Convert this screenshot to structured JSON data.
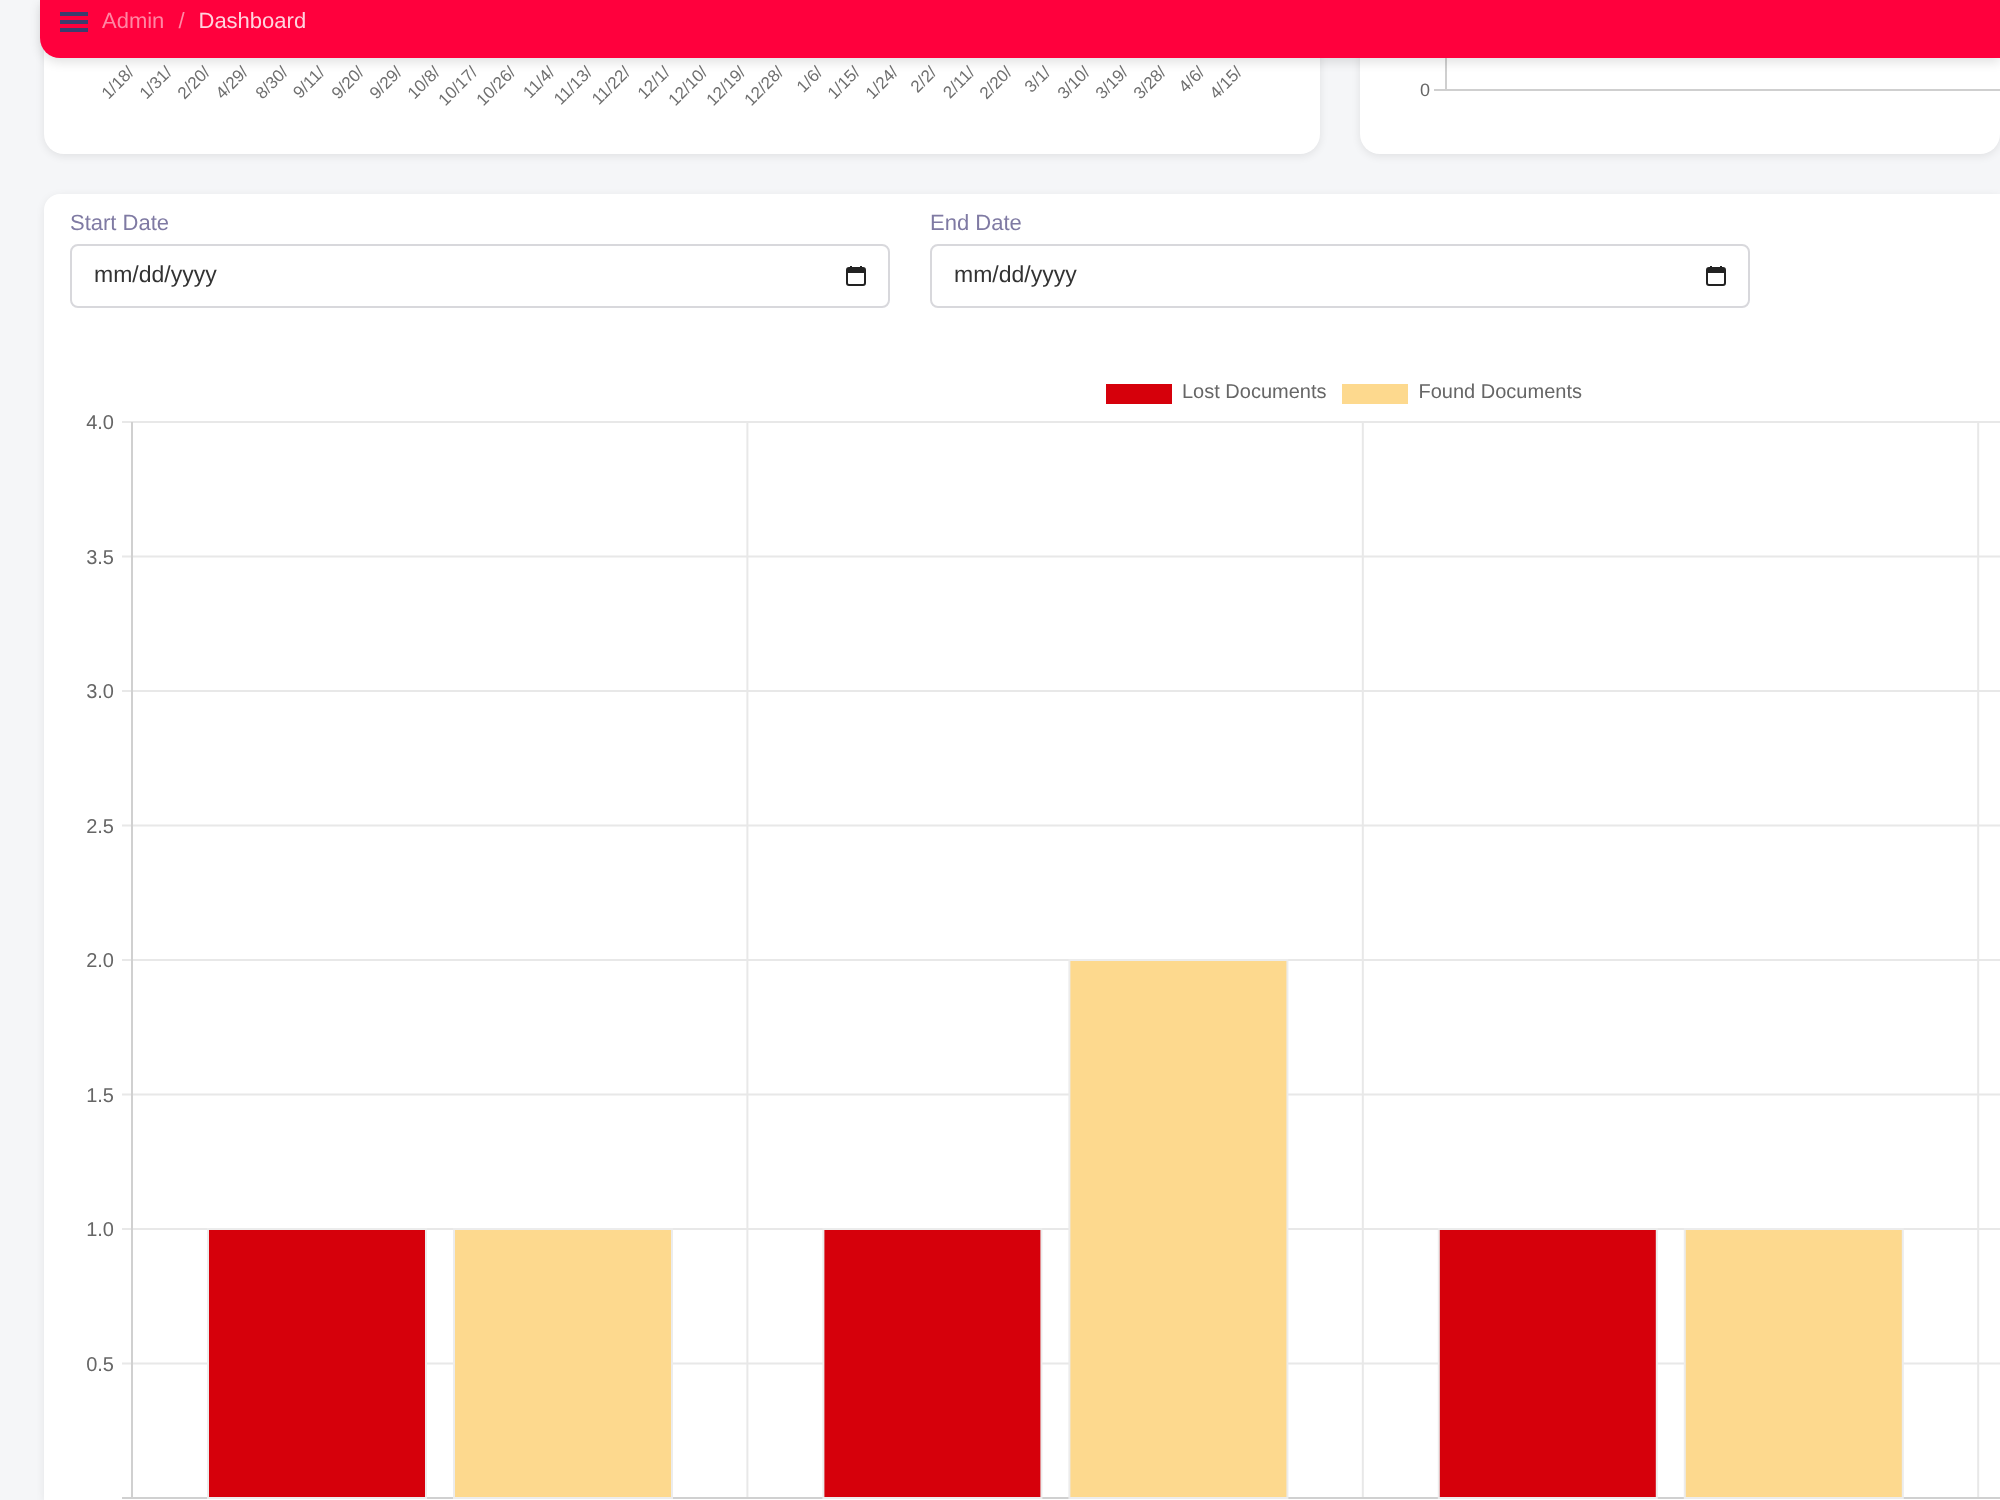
{
  "header": {
    "breadcrumb": [
      {
        "label": "Admin",
        "current": false
      },
      {
        "label": "Dashboard",
        "current": true
      }
    ],
    "separator": "/"
  },
  "activity_chart": {
    "x_labels": [
      "1/18/",
      "1/31/",
      "2/20/",
      "4/29/",
      "8/30/",
      "9/11/",
      "9/20/",
      "9/29/",
      "10/8/",
      "10/17/",
      "10/26/",
      "11/4/",
      "11/13/",
      "11/22/",
      "12/1/",
      "12/10/",
      "12/19/",
      "12/28/",
      "1/6/",
      "1/15/",
      "1/24/",
      "2/2/",
      "2/11/",
      "2/20/",
      "3/1/",
      "3/10/",
      "3/19/",
      "3/28/",
      "4/6/",
      "4/15/"
    ]
  },
  "summary_chart": {
    "y_labels": [
      "0"
    ]
  },
  "filters": [
    {
      "label": "Start Date",
      "placeholder": "mm/dd/yyyy"
    },
    {
      "label": "End Date",
      "placeholder": "mm/dd/yyyy"
    }
  ],
  "documents_chart": {
    "chart_data": {
      "type": "bar",
      "grid": true,
      "legend": "top",
      "series": [
        {
          "name": "Lost Documents",
          "color": "#d6000b",
          "values": [
            1,
            1,
            1
          ]
        },
        {
          "name": "Found Documents",
          "color": "#fdd98e",
          "values": [
            1,
            2,
            1
          ]
        }
      ],
      "ylim": [
        0,
        4
      ],
      "yticks": [
        {
          "value": 0.5,
          "label": "0.5"
        },
        {
          "value": 1,
          "label": "1.0"
        },
        {
          "value": 1.5,
          "label": "1.5"
        },
        {
          "value": 2,
          "label": "2.0"
        },
        {
          "value": 2.5,
          "label": "2.5"
        },
        {
          "value": 3,
          "label": "3.0"
        },
        {
          "value": 3.5,
          "label": "3.5"
        },
        {
          "value": 4,
          "label": "4.0"
        }
      ]
    }
  }
}
